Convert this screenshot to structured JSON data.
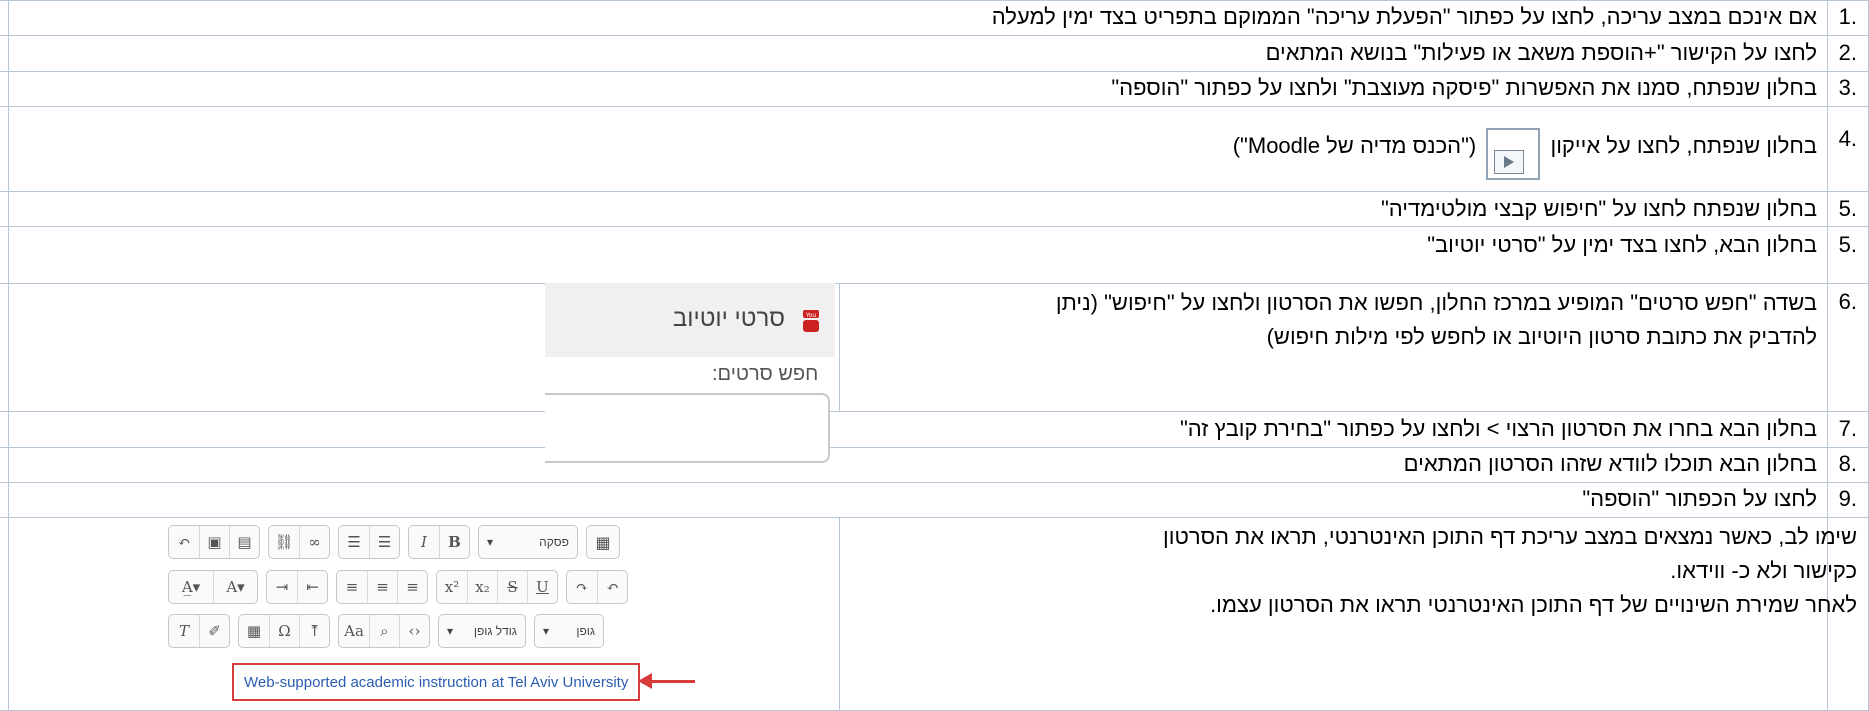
{
  "steps": [
    {
      "num": "1.",
      "text": "אם אינכם במצב עריכה, לחצו על כפתור \"הפעלת עריכה\" הממוקם בתפריט בצד ימין למעלה"
    },
    {
      "num": "2.",
      "text": "לחצו על הקישור \"+הוספת משאב או פעילות\" בנושא המתאים"
    },
    {
      "num": "3.",
      "text": "בחלון שנפתח, סמנו את האפשרות \"פיסקה מעוצבת\" ולחצו על כפתור \"הוספה\""
    },
    {
      "num": "4.",
      "text_before": "בחלון שנפתח, לחצו על אייקון",
      "text_after": "(\"הכנס מדיה של Moodle\")"
    },
    {
      "num": "5.",
      "text": "בחלון שנפתח לחצו על \"חיפוש קבצי מולטימדיה\""
    },
    {
      "num": "5.",
      "text": "בחלון הבא, לחצו בצד ימין על \"סרטי יוטיוב\""
    },
    {
      "num": "6.",
      "text": "בשדה \"חפש סרטים\" המופיע במרכז החלון, חפשו את הסרטון ולחצו על \"חיפוש\" (ניתן להדביק את כתובת סרטון היוטיוב או לחפש לפי מילות חיפוש)"
    },
    {
      "num": "7.",
      "text": "בחלון הבא בחרו את הסרטון הרצוי > ולחצו על כפתור \"בחירת קובץ זה\""
    },
    {
      "num": "8.",
      "text": "בחלון הבא תוכלו לוודא שזהו הסרטון המתאים"
    },
    {
      "num": "9.",
      "text": "לחצו על הכפתור \"הוספה\""
    }
  ],
  "note": {
    "line1": "שימו לב, כאשר נמצאים במצב עריכת דף התוכן האינטרנטי, תראו את הסרטון",
    "line2": "כקישור ולא כ- ווידאו.",
    "line3": "לאחר שמירת השינויים של דף התוכן האינטרנטי תראו את הסרטון עצמו."
  },
  "youtube_tab": {
    "label": "סרטי יוטיוב",
    "icon": "youtube-icon",
    "icon_color": "#cc2222"
  },
  "search": {
    "label": "חפש סרטים:"
  },
  "editor": {
    "paragraph_select": "פסקה",
    "font_size_select": "גודל גופן",
    "font_select": "גופן",
    "link_text": "Web-supported academic instruction at Tel Aviv University",
    "highlight_color": "#d93a3a"
  },
  "colors": {
    "grid": "#b7c7d6",
    "link": "#2a5db0"
  }
}
